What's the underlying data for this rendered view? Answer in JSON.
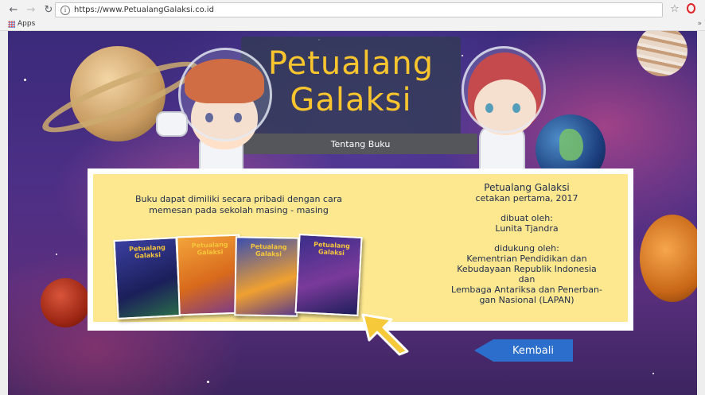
{
  "browser": {
    "url": "https://www.PetualangGalaksi.co.id",
    "bookmarks_apps": "Apps",
    "bookmarks_more": "»"
  },
  "page": {
    "title_line1": "Petualang",
    "title_line2": "Galaksi",
    "tab_label": "Tentang Buku",
    "left_text_line1": "Buku dapat dimiliki secara pribadi dengan cara",
    "left_text_line2": "memesan pada sekolah masing - masing",
    "right": {
      "title": "Petualang Galaksi",
      "edition": "cetakan pertama, 2017",
      "made_by_label": "dibuat oleh:",
      "made_by": "Lunita Tjandra",
      "supported_label": "didukung oleh:",
      "supporter1_line1": "Kementrian Pendidikan dan",
      "supporter1_line2": "Kebudayaan Republik Indonesia",
      "connector": "dan",
      "supporter2_line1": "Lembaga Antariksa dan Penerban-",
      "supporter2_line2": "gan Nasional (LAPAN)"
    },
    "book_cover_title": "Petualang Galaksi",
    "back_button": "Kembali"
  },
  "colors": {
    "title": "#f8c52e",
    "panel": "#fde88f",
    "back_button": "#2c6ecb",
    "text": "#1f2b4d"
  },
  "icons": [
    "back-arrow-icon",
    "forward-arrow-icon",
    "reload-icon",
    "info-icon",
    "bookmark-star-icon",
    "opera-icon",
    "apps-grid-icon",
    "pointer-arrow-icon"
  ]
}
